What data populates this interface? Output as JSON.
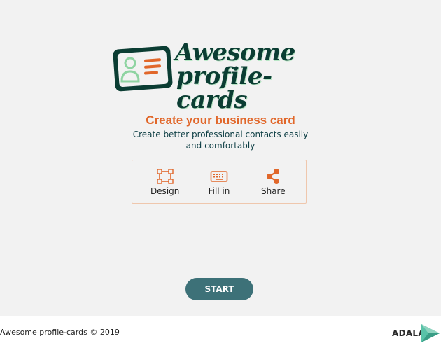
{
  "logo": {
    "line1": "Awesome",
    "line2": "profile-cards",
    "icon": "profile-card-icon"
  },
  "hero": {
    "title": "Create your business card",
    "subtitle": "Create better professional contacts easily and comfortably"
  },
  "steps": [
    {
      "label": "Design",
      "icon": "design-icon"
    },
    {
      "label": "Fill in",
      "icon": "keyboard-icon"
    },
    {
      "label": "Share",
      "icon": "share-icon"
    }
  ],
  "start_button": {
    "label": "START"
  },
  "footer": {
    "copyright": "Awesome profile-cards © 2019",
    "brand": "ADALAB"
  },
  "colors": {
    "accent_orange": "#e1672a",
    "dark_green": "#0b3d33",
    "button_teal": "#3d7178",
    "background": "#f2f2f2"
  }
}
